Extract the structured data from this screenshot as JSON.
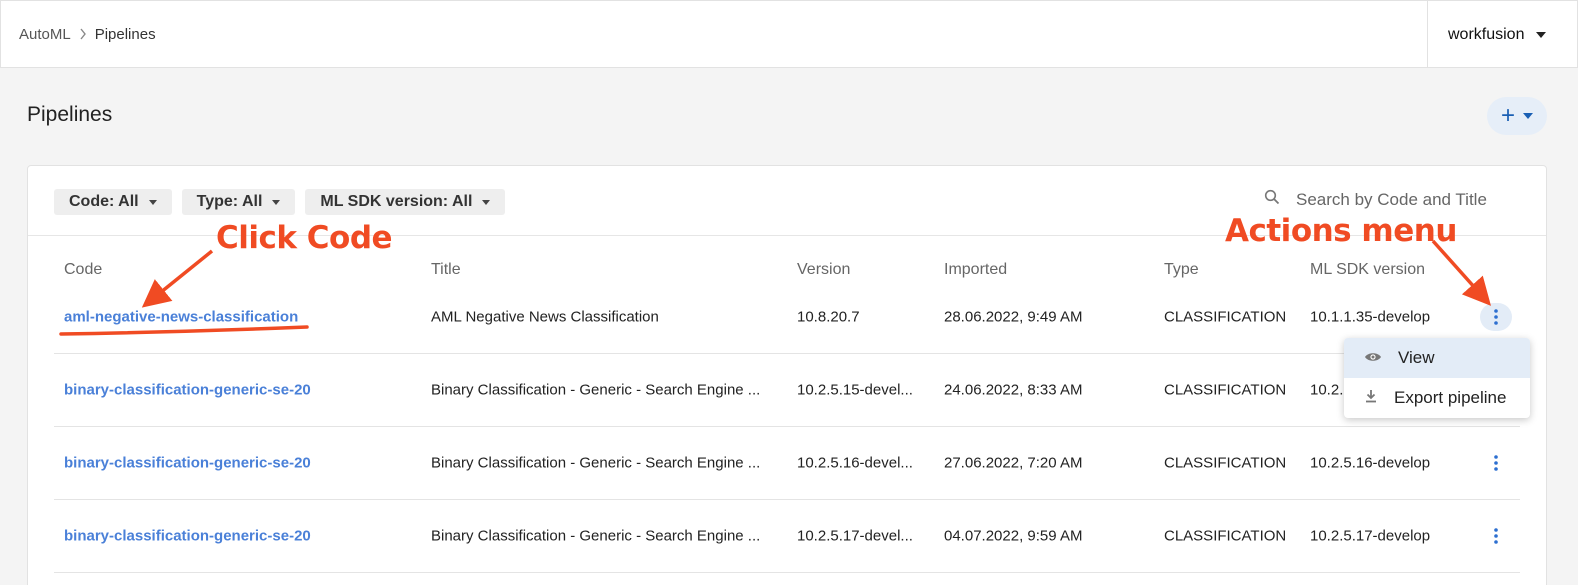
{
  "breadcrumb": {
    "root": "AutoML",
    "separator": ">",
    "current": "Pipelines"
  },
  "user_menu": {
    "label": "workfusion"
  },
  "page": {
    "title": "Pipelines",
    "add_label": "+"
  },
  "filters": [
    {
      "label": "Code: All"
    },
    {
      "label": "Type: All"
    },
    {
      "label": "ML SDK version: All"
    }
  ],
  "search": {
    "placeholder": "Search by Code and Title"
  },
  "table": {
    "columns": [
      "Code",
      "Title",
      "Version",
      "Imported",
      "Type",
      "ML SDK version"
    ],
    "rows": [
      {
        "code": "aml-negative-news-classification",
        "title": "AML Negative News Classification",
        "version": "10.8.20.7",
        "imported": "28.06.2022, 9:49 AM",
        "type": "CLASSIFICATION",
        "sdk": "10.1.1.35-develop"
      },
      {
        "code": "binary-classification-generic-se-20",
        "title": "Binary Classification - Generic - Search Engine ...",
        "version": "10.2.5.15-devel...",
        "imported": "24.06.2022, 8:33 AM",
        "type": "CLASSIFICATION",
        "sdk": "10.2."
      },
      {
        "code": "binary-classification-generic-se-20",
        "title": "Binary Classification - Generic - Search Engine ...",
        "version": "10.2.5.16-devel...",
        "imported": "27.06.2022, 7:20 AM",
        "type": "CLASSIFICATION",
        "sdk": "10.2.5.16-develop"
      },
      {
        "code": "binary-classification-generic-se-20",
        "title": "Binary Classification - Generic - Search Engine ...",
        "version": "10.2.5.17-devel...",
        "imported": "04.07.2022, 9:59 AM",
        "type": "CLASSIFICATION",
        "sdk": "10.2.5.17-develop"
      }
    ]
  },
  "actions_menu": {
    "items": [
      {
        "label": "View",
        "icon": "eye-icon"
      },
      {
        "label": "Export pipeline",
        "icon": "download-icon"
      }
    ]
  },
  "annotations": {
    "click_code": "Click Code",
    "actions_menu": "Actions menu",
    "color": "#f04b23"
  },
  "colors": {
    "link": "#4a80d8",
    "accent": "#1a5fb4",
    "highlight": "#e3ecf7"
  }
}
